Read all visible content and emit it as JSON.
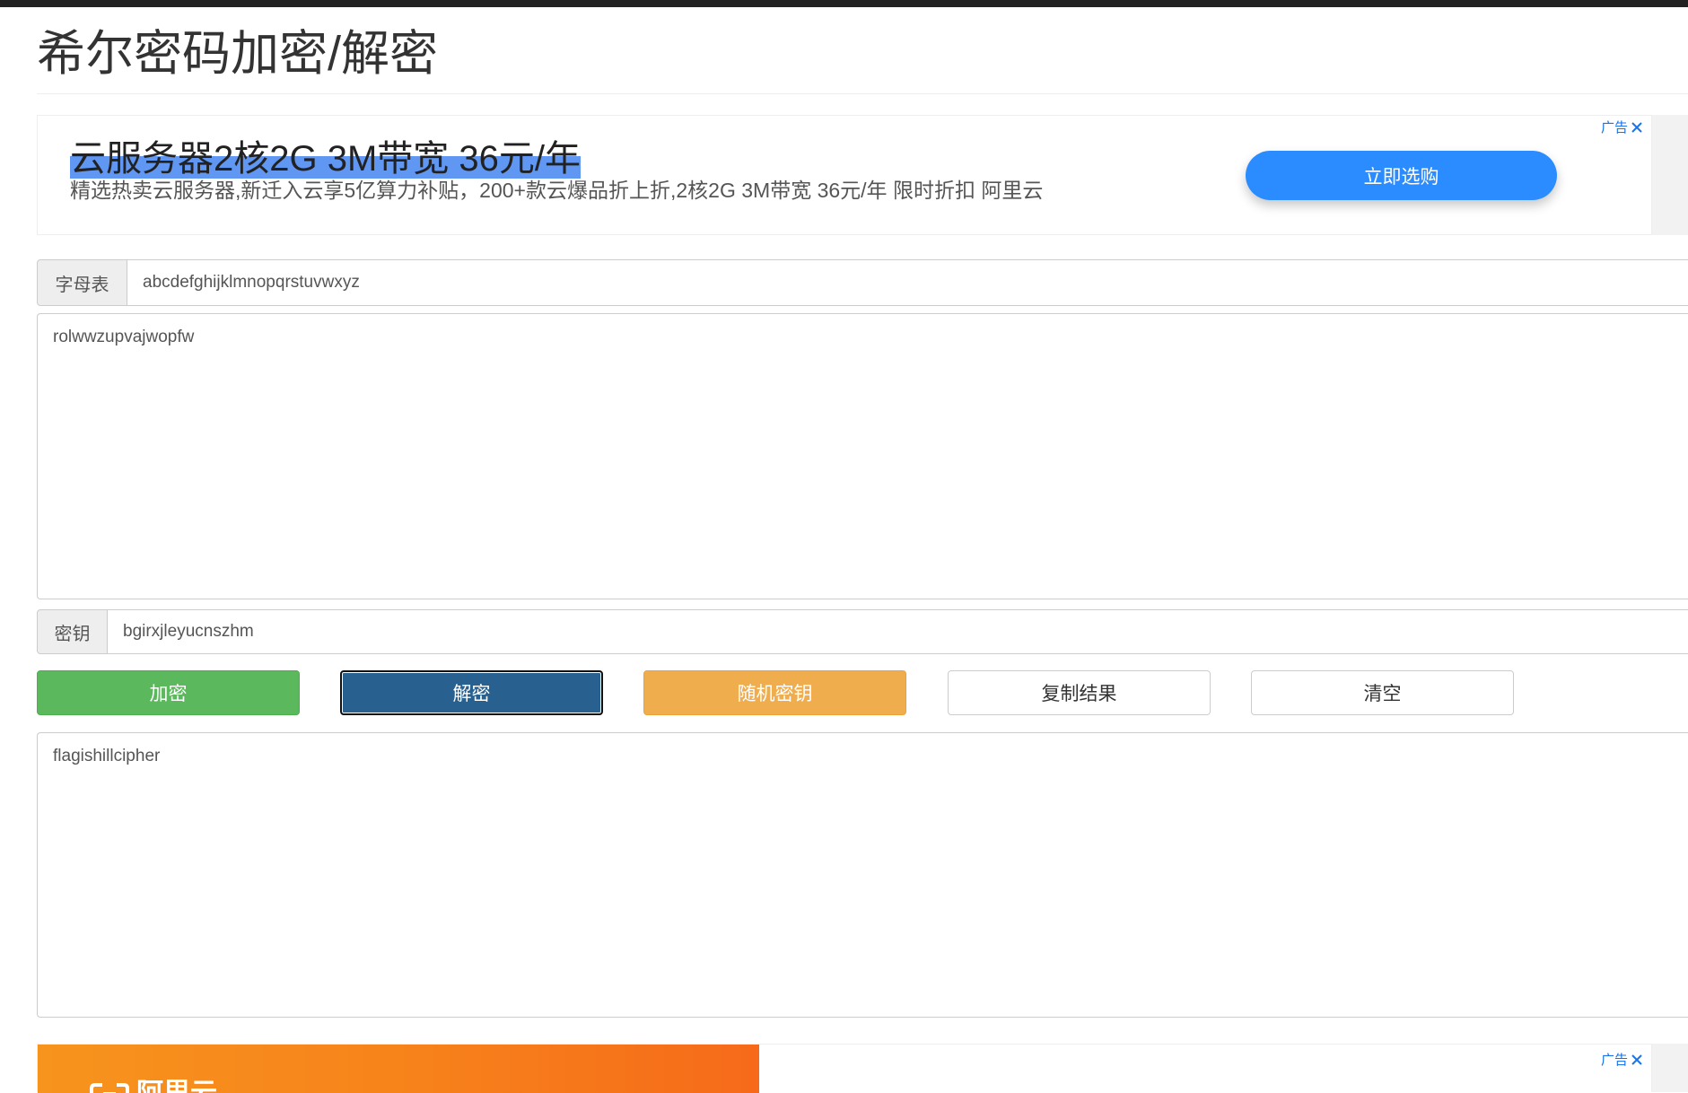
{
  "page": {
    "title": "希尔密码加密/解密"
  },
  "ad_top": {
    "label": "广告",
    "close_icon": "close-icon",
    "headline": "云服务器2核2G 3M带宽 36元/年",
    "description": "精选热卖云服务器,新迁入云享5亿算力补贴，200+款云爆品折上折,2核2G 3M带宽 36元/年 限时折扣 阿里云",
    "cta_label": "立即选购"
  },
  "cipher": {
    "alphabet_label": "字母表",
    "alphabet_value": "abcdefghijklmnopqrstuvwxyz",
    "input_text": "rolwwzupvajwopfw",
    "key_label": "密钥",
    "key_value": "bgirxjleyucnszhm",
    "output_text": "flagishillcipher"
  },
  "actions": {
    "encrypt_label": "加密",
    "decrypt_label": "解密",
    "random_key_label": "随机密钥",
    "copy_label": "复制结果",
    "clear_label": "清空"
  },
  "ad_bottom": {
    "label": "广告",
    "close_icon": "close-icon",
    "logo_text": "阿里云"
  },
  "colors": {
    "encrypt": "#5cb85c",
    "decrypt": "#286090",
    "random_key": "#f0ad4e",
    "ad_cta": "#2b8cff",
    "ad_label": "#1a73e8",
    "ad_banner_orange": "#f7941d"
  }
}
